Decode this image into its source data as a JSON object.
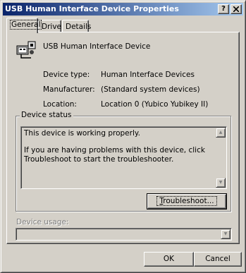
{
  "window": {
    "title": "USB Human Interface Device Properties",
    "help_label": "?",
    "close_label": "x"
  },
  "tabs": [
    {
      "label": "General",
      "active": true
    },
    {
      "label": "Driver",
      "active": false
    },
    {
      "label": "Details",
      "active": false
    }
  ],
  "device": {
    "name": "USB Human Interface Device",
    "icon": "usb-device-icon",
    "properties": [
      {
        "label": "Device type:",
        "value": "Human Interface Devices"
      },
      {
        "label": "Manufacturer:",
        "value": "(Standard system devices)"
      },
      {
        "label": "Location:",
        "value": "Location 0 (Yubico Yubikey II)"
      }
    ]
  },
  "status": {
    "group_label": "Device status",
    "line1": "This device is working properly.",
    "line2": "If you are having problems with this device, click Troubleshoot to start the troubleshooter.",
    "troubleshoot_label": "Troubleshoot...",
    "troubleshoot_accel": "T",
    "troubleshoot_rest": "roubleshoot..."
  },
  "usage": {
    "label": "Device usage:",
    "selected": ""
  },
  "footer": {
    "ok_label": "OK",
    "cancel_label": "Cancel"
  }
}
